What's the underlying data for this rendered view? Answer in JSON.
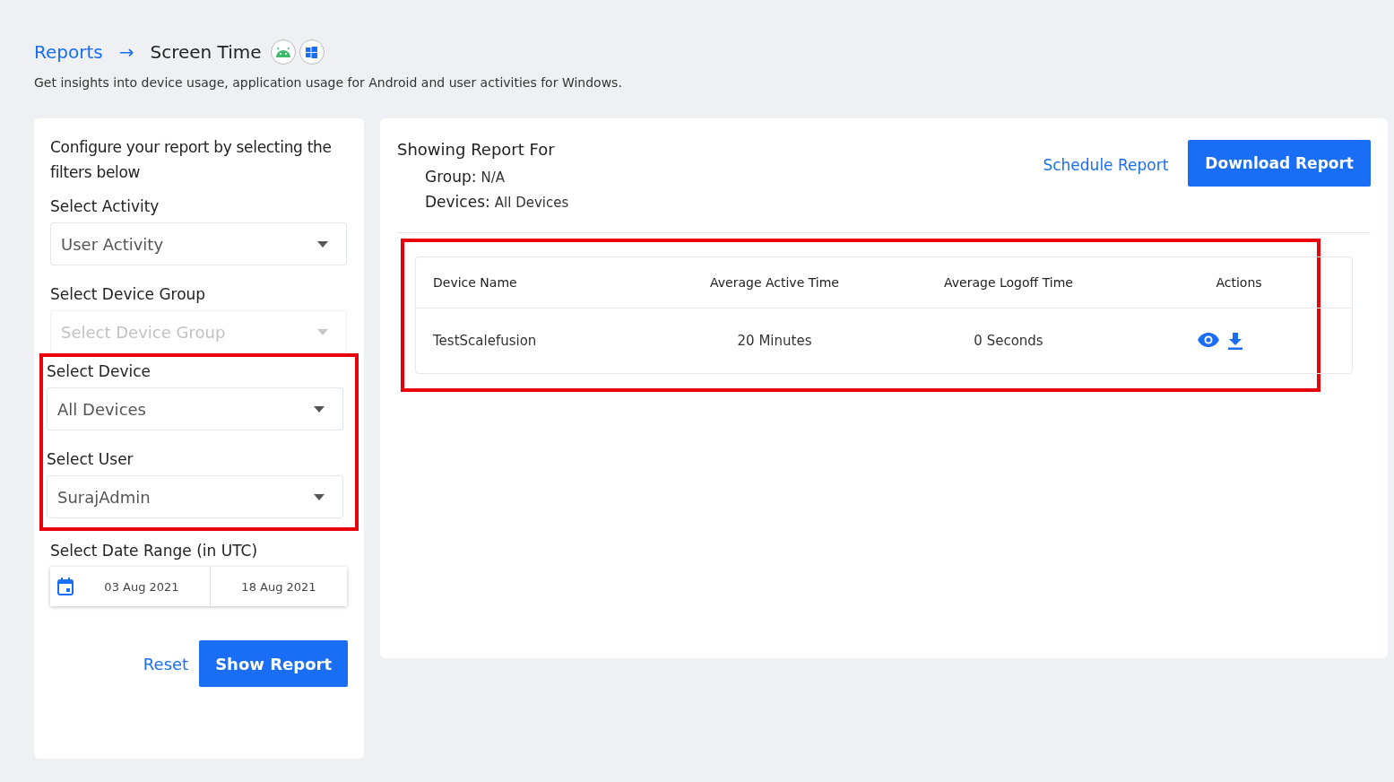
{
  "breadcrumb": {
    "parent": "Reports",
    "separator": "→",
    "current": "Screen Time"
  },
  "description": "Get insights into device usage, application usage for Android and user activities for Windows.",
  "filters": {
    "intro": "Configure your report by selecting the filters below",
    "groups": [
      {
        "highlighted": false,
        "fields": [
          {
            "kind": "select",
            "label": "Select Activity",
            "value": "User Activity",
            "disabled": false
          },
          {
            "kind": "select",
            "label": "Select Device Group",
            "placeholder": "Select Device Group",
            "disabled": true
          }
        ]
      },
      {
        "highlighted": true,
        "fields": [
          {
            "kind": "select",
            "label": "Select Device",
            "value": "All Devices",
            "disabled": false
          },
          {
            "kind": "select",
            "label": "Select User",
            "value": "SurajAdmin",
            "disabled": false
          }
        ]
      },
      {
        "highlighted": false,
        "fields": [
          {
            "kind": "date_range",
            "label": "Select Date Range (in UTC)",
            "start": "03 Aug 2021",
            "end": "18 Aug 2021"
          }
        ]
      }
    ],
    "buttons": {
      "reset": "Reset",
      "submit": "Show Report"
    }
  },
  "report": {
    "title": "Showing Report For",
    "group_label": "Group:",
    "group_value": "N/A",
    "devices_label": "Devices:",
    "devices_value": "All Devices",
    "schedule": "Schedule Report",
    "download": "Download Report",
    "table": {
      "highlighted": true,
      "columns": [
        "Device Name",
        "Average Active Time",
        "Average Logoff Time",
        "Actions"
      ],
      "rows": [
        {
          "cells": [
            "TestScalefusion",
            "20 Minutes",
            "0 Seconds"
          ]
        }
      ]
    }
  }
}
